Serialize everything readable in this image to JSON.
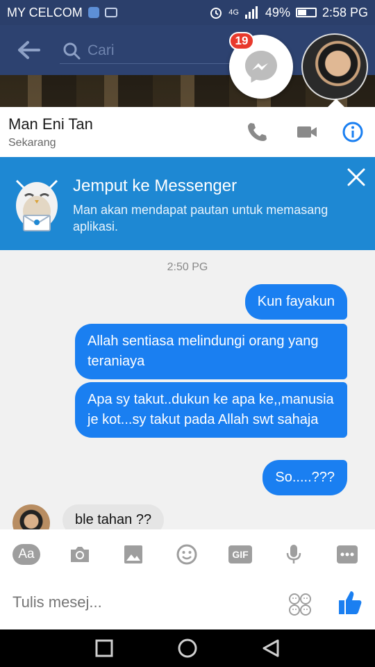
{
  "status_bar": {
    "carrier": "MY CELCOM",
    "signal_label": "4G",
    "battery": "49%",
    "battery_level": 0.49,
    "time": "2:58 PG"
  },
  "header": {
    "search_placeholder": "Cari",
    "badge_count": "19"
  },
  "contact": {
    "name": "Man Eni Tan",
    "status": "Sekarang"
  },
  "invite": {
    "title": "Jemput ke Messenger",
    "description": "Man akan mendapat pautan untuk memasang aplikasi."
  },
  "chat": {
    "timestamp": "2:50 PG",
    "outgoing": [
      "Kun fayakun",
      "Allah sentiasa melindungi orang yang teraniaya",
      "Apa sy takut..dukun ke apa ke,,manusia je kot...sy takut pada Allah swt sahaja",
      "So.....???"
    ],
    "incoming": [
      "ble tahan ??"
    ]
  },
  "composer": {
    "text_tool": "Aa",
    "gif_tool": "GIF",
    "placeholder": "Tulis mesej..."
  },
  "colors": {
    "status_bar": "#2b3f6b",
    "banner": "#1e88d3",
    "outgoing_bubble": "#1a7ff1",
    "incoming_bubble": "#e5e5e5",
    "badge": "#e8392c"
  }
}
